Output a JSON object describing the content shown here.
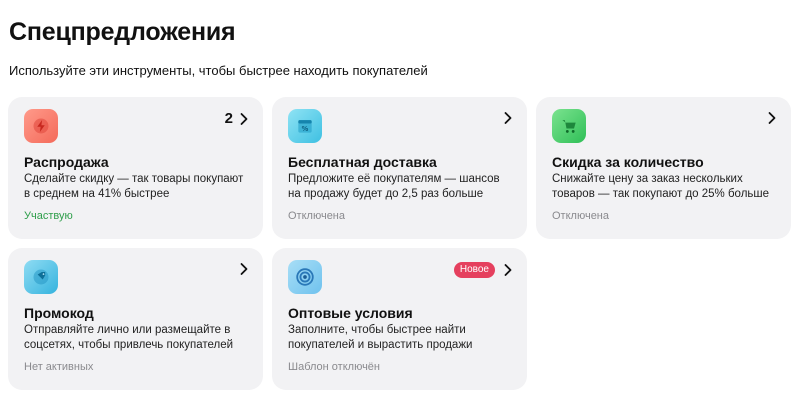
{
  "page": {
    "title": "Спецпредложения",
    "subtitle": "Используйте эти инструменты, чтобы быстрее находить покупателей"
  },
  "cards": [
    {
      "icon": "lightning-icon",
      "title": "Распродажа",
      "description": "Сделайте скидку — так товары покупают в среднем на 41% быстрее",
      "status": "Участвую",
      "count": "2",
      "badge": ""
    },
    {
      "icon": "percent-box-icon",
      "title": "Бесплатная доставка",
      "description": "Предложите её покупателям — шансов на продажу будет до 2,5 раз больше",
      "status": "Отключена",
      "count": "",
      "badge": ""
    },
    {
      "icon": "cart-icon",
      "title": "Скидка за количество",
      "description": "Снижайте цену за заказ нескольких товаров — так покупают до 25% больше",
      "status": "Отключена",
      "count": "",
      "badge": ""
    },
    {
      "icon": "tag-icon",
      "title": "Промокод",
      "description": "Отправляйте лично или размещайте в соцсетях, чтобы привлечь покупателей",
      "status": "Нет активных",
      "count": "",
      "badge": ""
    },
    {
      "icon": "target-icon",
      "title": "Оптовые условия",
      "description": "Заполните, чтобы быстрее найти покупателей и вырастить продажи",
      "status": "Шаблон отключён",
      "count": "",
      "badge": "Новое"
    }
  ],
  "colors": {
    "card_bg": "#f2f2f4",
    "status_active": "#2e9e4a",
    "status_muted": "#8a8a8e",
    "badge_new": "#e5405e"
  }
}
